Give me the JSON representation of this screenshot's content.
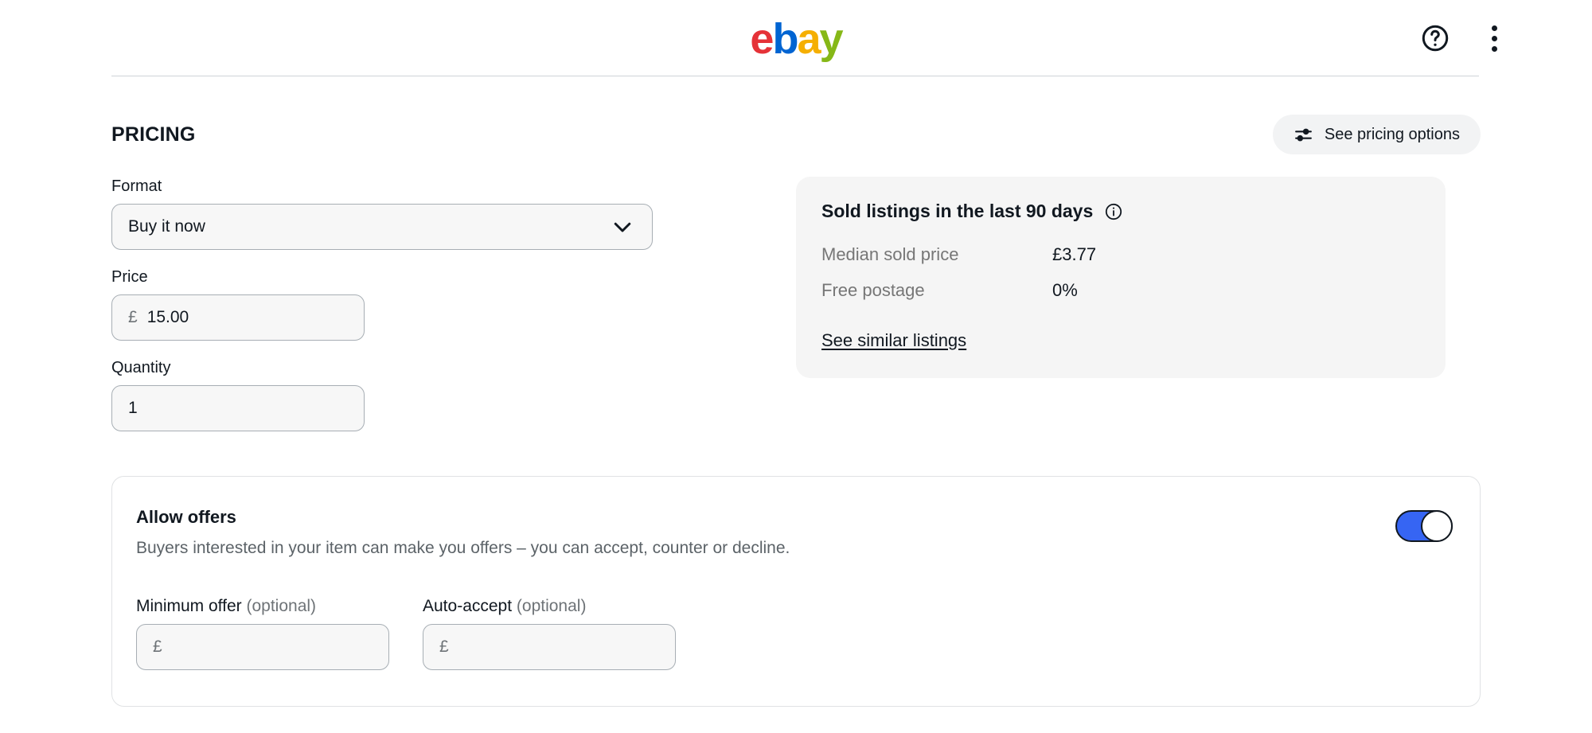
{
  "header": {
    "logo": {
      "e": "e",
      "b": "b",
      "a": "a",
      "y": "y"
    },
    "help_icon": "help-circle-icon",
    "menu_icon": "more-vertical-icon"
  },
  "section": {
    "title": "PRICING",
    "pricing_options_button": "See pricing options",
    "pricing_options_icon": "sliders-icon"
  },
  "form": {
    "format": {
      "label": "Format",
      "value": "Buy it now",
      "chevron_icon": "chevron-down-icon"
    },
    "price": {
      "label": "Price",
      "currency_symbol": "£",
      "value": "15.00"
    },
    "quantity": {
      "label": "Quantity",
      "value": "1"
    }
  },
  "sold_listings": {
    "title": "Sold listings in the last 90 days",
    "info_icon": "info-icon",
    "rows": [
      {
        "label": "Median sold price",
        "value": "£3.77"
      },
      {
        "label": "Free postage",
        "value": "0%"
      }
    ],
    "link": "See similar listings"
  },
  "allow_offers": {
    "title": "Allow offers",
    "description": "Buyers interested in your item can make you offers – you can accept, counter or decline.",
    "toggle_state": "on",
    "toggle_color": "#3665f3",
    "minimum_offer": {
      "label": "Minimum offer ",
      "optional": "(optional)",
      "placeholder": "£",
      "value": ""
    },
    "auto_accept": {
      "label": "Auto-accept ",
      "optional": "(optional)",
      "placeholder": "£",
      "value": ""
    }
  }
}
